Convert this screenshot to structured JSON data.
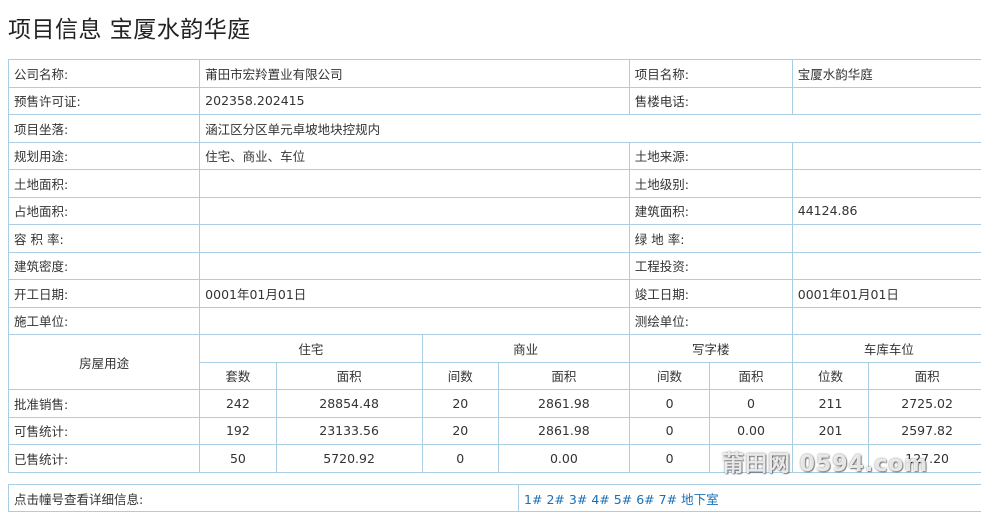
{
  "title": "项目信息 宝厦水韵华庭",
  "info": {
    "company_label": "公司名称:",
    "company": "莆田市宏羚置业有限公司",
    "project_label": "项目名称:",
    "project": "宝厦水韵华庭",
    "permit_label": "预售许可证:",
    "permit": "202358.202415",
    "phone_label": "售楼电话:",
    "phone": "",
    "location_label": "项目坐落:",
    "location": "涵江区分区单元卓坡地块控规内",
    "usage_label": "规划用途:",
    "usage": "住宅、商业、车位",
    "land_source_label": "土地来源:",
    "land_source": "",
    "land_area_label": "土地面积:",
    "land_area": "",
    "land_grade_label": "土地级别:",
    "land_grade": "",
    "occupy_area_label": "占地面积:",
    "occupy_area": "",
    "build_area_label": "建筑面积:",
    "build_area": "44124.86",
    "far_label": "容 积 率:",
    "far": "",
    "green_label": "绿 地 率:",
    "green": "",
    "density_label": "建筑密度:",
    "density": "",
    "invest_label": "工程投资:",
    "invest": "",
    "start_label": "开工日期:",
    "start": "0001年01月01日",
    "finish_label": "竣工日期:",
    "finish": "0001年01月01日",
    "builder_label": "施工单位:",
    "builder": "",
    "surveyor_label": "测绘单位:",
    "surveyor": ""
  },
  "stats": {
    "row_header": "房屋用途",
    "groups": [
      "住宅",
      "商业",
      "写字楼",
      "车库车位"
    ],
    "sub": [
      "套数",
      "面积",
      "间数",
      "面积",
      "间数",
      "面积",
      "位数",
      "面积"
    ],
    "rows": [
      {
        "label": "批准销售:",
        "values": [
          "242",
          "28854.48",
          "20",
          "2861.98",
          "0",
          "0",
          "211",
          "2725.02"
        ]
      },
      {
        "label": "可售统计:",
        "values": [
          "192",
          "23133.56",
          "20",
          "2861.98",
          "0",
          "0.00",
          "201",
          "2597.82"
        ]
      },
      {
        "label": "已售统计:",
        "values": [
          "50",
          "5720.92",
          "0",
          "0.00",
          "0",
          "",
          "",
          "127.20"
        ]
      }
    ]
  },
  "links": {
    "label": "点击幢号查看详细信息:",
    "items": [
      "1#",
      "2#",
      "3#",
      "4#",
      "5#",
      "6#",
      "7#",
      "地下室"
    ]
  },
  "watermark": "莆田网 0594.com"
}
